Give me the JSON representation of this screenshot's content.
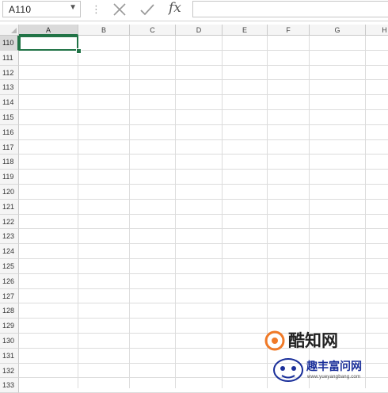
{
  "formula_bar": {
    "name_box": "A110",
    "name_box_icon": "chevron-down-icon",
    "separator": "⋮",
    "cancel_icon": "cancel-icon",
    "enter_icon": "check-icon",
    "function_label": "fx",
    "formula": ""
  },
  "sheet": {
    "columns": [
      "A",
      "B",
      "C",
      "D",
      "E",
      "F",
      "G",
      "H"
    ],
    "rows": [
      "110",
      "111",
      "112",
      "113",
      "114",
      "115",
      "116",
      "117",
      "118",
      "119",
      "120",
      "121",
      "122",
      "123",
      "124",
      "125",
      "126",
      "127",
      "128",
      "129",
      "130",
      "131",
      "132",
      "133"
    ],
    "active_cell": "A110",
    "accent_color": "#217346"
  },
  "watermark": {
    "logo_1": "酷知网",
    "logo_2": "趣丰富问网",
    "url": "www.yueyangbang.com"
  }
}
